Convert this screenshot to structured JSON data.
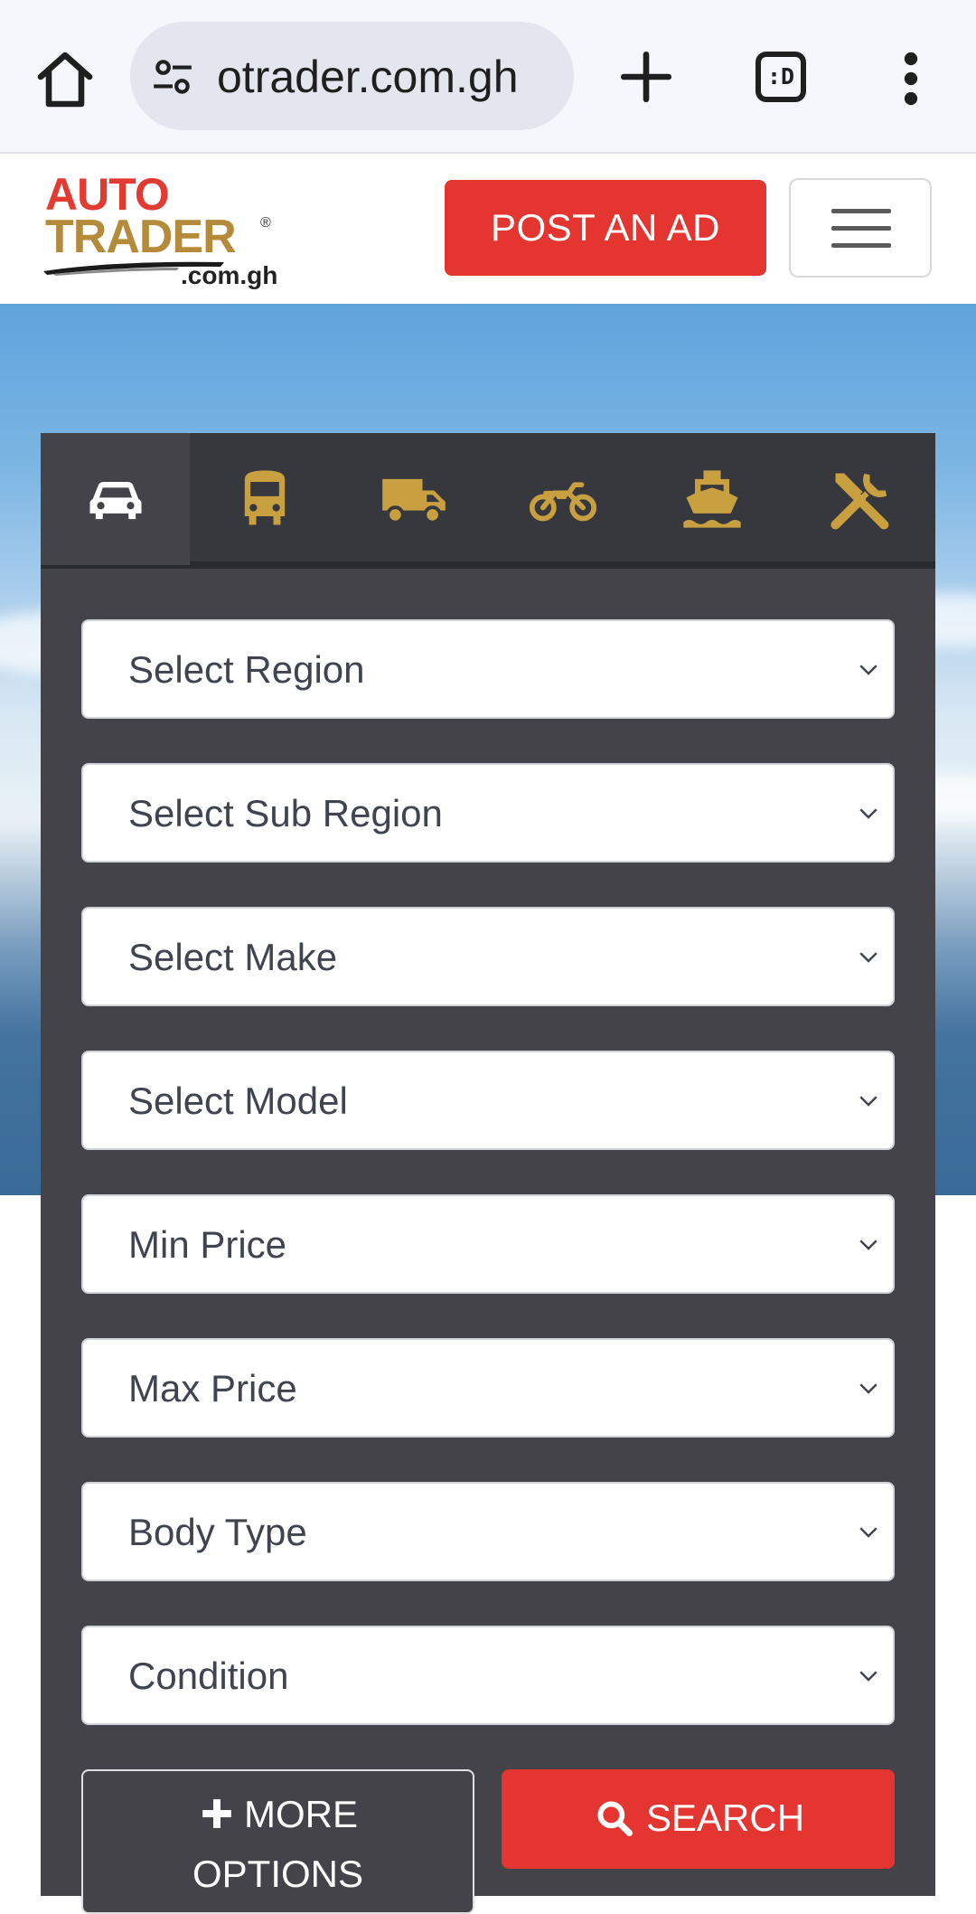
{
  "browser": {
    "url": "otrader.com.gh",
    "tab_count_label": ":D"
  },
  "header": {
    "logo_auto": "AUTO",
    "logo_trader": "TRADER",
    "logo_reg": "®",
    "logo_domain": ".com.gh",
    "post_ad_label": "POST AN AD"
  },
  "search": {
    "vehicle_tabs": [
      {
        "name": "car",
        "icon": "car-icon",
        "active": true
      },
      {
        "name": "bus",
        "icon": "bus-icon",
        "active": false
      },
      {
        "name": "truck",
        "icon": "truck-icon",
        "active": false
      },
      {
        "name": "motorcycle",
        "icon": "motorcycle-icon",
        "active": false
      },
      {
        "name": "boat",
        "icon": "ship-icon",
        "active": false
      },
      {
        "name": "parts",
        "icon": "tools-icon",
        "active": false
      }
    ],
    "selects": [
      {
        "label": "Select Region"
      },
      {
        "label": "Select Sub Region"
      },
      {
        "label": "Select Make"
      },
      {
        "label": "Select Model"
      },
      {
        "label": "Min Price"
      },
      {
        "label": "Max Price"
      },
      {
        "label": "Body Type"
      },
      {
        "label": "Condition"
      }
    ],
    "more_options_line1": "MORE",
    "more_options_line2": "OPTIONS",
    "search_label": "SEARCH"
  },
  "colors": {
    "brand_red": "#e53530",
    "icon_gold": "#c8a040",
    "panel_bg": "#434349"
  }
}
